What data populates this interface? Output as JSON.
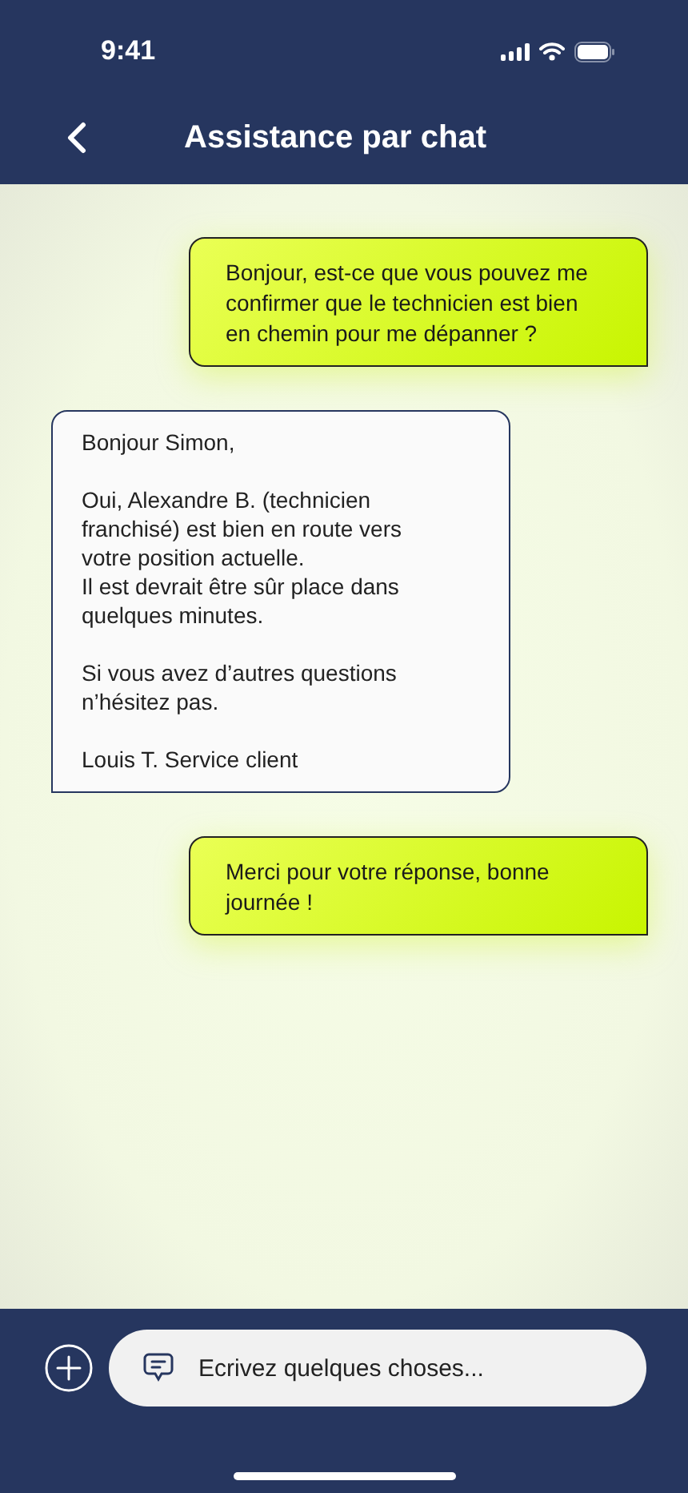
{
  "status_bar": {
    "time": "9:41"
  },
  "header": {
    "title": "Assistance par chat"
  },
  "messages": [
    {
      "kind": "sent",
      "text": "Bonjour, est-ce que vous pouvez me confirmer que le technicien est bien en chemin pour me dépanner ?"
    },
    {
      "kind": "received",
      "text": "Bonjour Simon,\n\nOui, Alexandre B. (technicien franchisé) est bien en route vers votre position actuelle.\nIl est devrait être sûr place dans quelques minutes.\n\nSi vous avez d’autres questions n’hésitez pas.\n\nLouis T. Service client"
    },
    {
      "kind": "sent",
      "text": "Merci pour votre réponse, bonne journée !"
    }
  ],
  "composer": {
    "placeholder": "Ecrivez quelques choses..."
  }
}
